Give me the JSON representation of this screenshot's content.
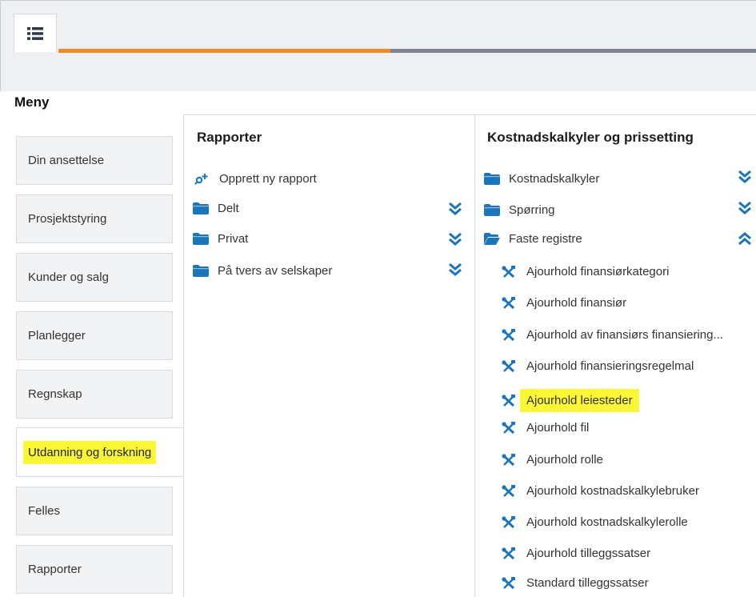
{
  "topbar": {
    "menu_icon": "list-icon",
    "progress_color_done": "#ef8a2b",
    "progress_color_rest": "#7d8590"
  },
  "menu": {
    "title": "Meny",
    "items": [
      {
        "label": "Din ansettelse"
      },
      {
        "label": "Prosjektstyring"
      },
      {
        "label": "Kunder og salg"
      },
      {
        "label": "Planlegger"
      },
      {
        "label": "Regnskap"
      },
      {
        "label": "Utdanning og forskning",
        "active": true
      },
      {
        "label": "Felles"
      },
      {
        "label": "Rapporter"
      }
    ]
  },
  "rapporter": {
    "title": "Rapporter",
    "create_label": "Opprett ny rapport",
    "folders": [
      {
        "label": "Delt"
      },
      {
        "label": "Privat"
      },
      {
        "label": "På tvers av selskaper"
      }
    ]
  },
  "kostnad": {
    "title": "Kostnadskalkyler og prissetting",
    "folders": [
      {
        "label": "Kostnadskalkyler",
        "expanded": false
      },
      {
        "label": "Spørring",
        "expanded": false
      },
      {
        "label": "Faste registre",
        "expanded": true
      }
    ],
    "items": [
      {
        "label": "Ajourhold finansiørkategori"
      },
      {
        "label": "Ajourhold finansiør"
      },
      {
        "label": "Ajourhold av finansiørs finansiering..."
      },
      {
        "label": "Ajourhold finansieringsregelmal"
      },
      {
        "label": "Ajourhold leiesteder",
        "highlighted": true
      },
      {
        "label": "Ajourhold fil"
      },
      {
        "label": "Ajourhold rolle"
      },
      {
        "label": "Ajourhold kostnadskalkylebruker"
      },
      {
        "label": "Ajourhold kostnadskalkylerolle"
      },
      {
        "label": "Ajourhold tilleggssatser"
      },
      {
        "label": "Standard tilleggssatser"
      }
    ]
  },
  "colors": {
    "accent_blue": "#1b75bb",
    "highlight": "#fbf635"
  }
}
